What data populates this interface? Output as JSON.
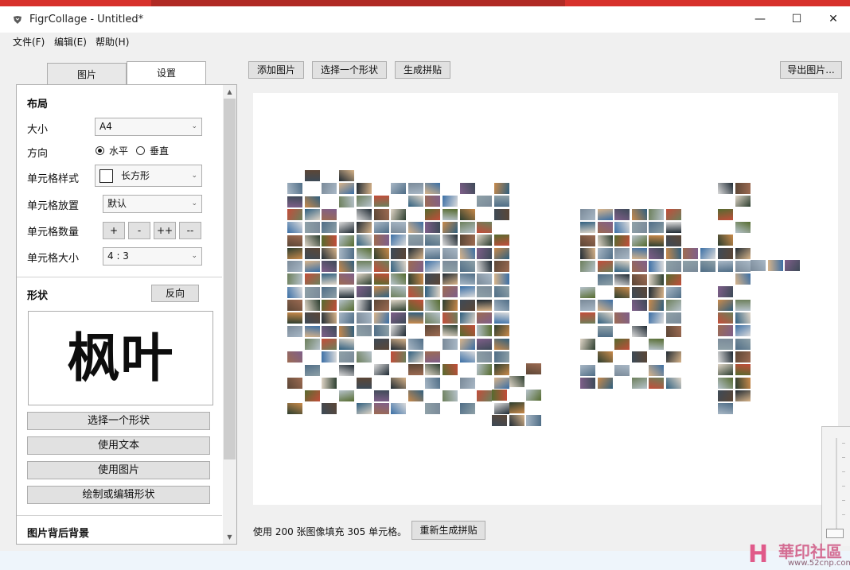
{
  "window": {
    "title": "FigrCollage - Untitled*",
    "minimize": "—",
    "maximize": "☐",
    "close": "✕"
  },
  "menu": [
    "文件(F)",
    "编辑(E)",
    "帮助(H)"
  ],
  "tabs": [
    "图片",
    "设置"
  ],
  "toolbar": {
    "add_images": "添加图片",
    "select_shape": "选择一个形状",
    "generate": "生成拼贴",
    "export": "导出图片..."
  },
  "layout": {
    "title": "布局",
    "size_label": "大小",
    "size_value": "A4",
    "orientation_label": "方向",
    "orientation_horizontal": "水平",
    "orientation_vertical": "垂直",
    "cell_style_label": "单元格样式",
    "cell_style_value": "长方形",
    "cell_placement_label": "单元格放置",
    "cell_placement_value": "默认",
    "cell_count_label": "单元格数量",
    "cell_count_buttons": [
      "+",
      "-",
      "++",
      "--"
    ],
    "cell_size_label": "单元格大小",
    "cell_size_value": "4 : 3"
  },
  "shape": {
    "title": "形状",
    "reverse": "反向",
    "preview_text": "枫叶",
    "select_shape": "选择一个形状",
    "use_text": "使用文本",
    "use_image": "使用图片",
    "draw_edit": "绘制或编辑形状"
  },
  "background": {
    "title": "图片背后背景"
  },
  "status": {
    "text": "使用 200 张图像填充 305 单元格。",
    "regenerate": "重新生成拼贴"
  },
  "watermark": {
    "logo": "H",
    "text": "華印社區",
    "url": "www.52cnp.com"
  }
}
